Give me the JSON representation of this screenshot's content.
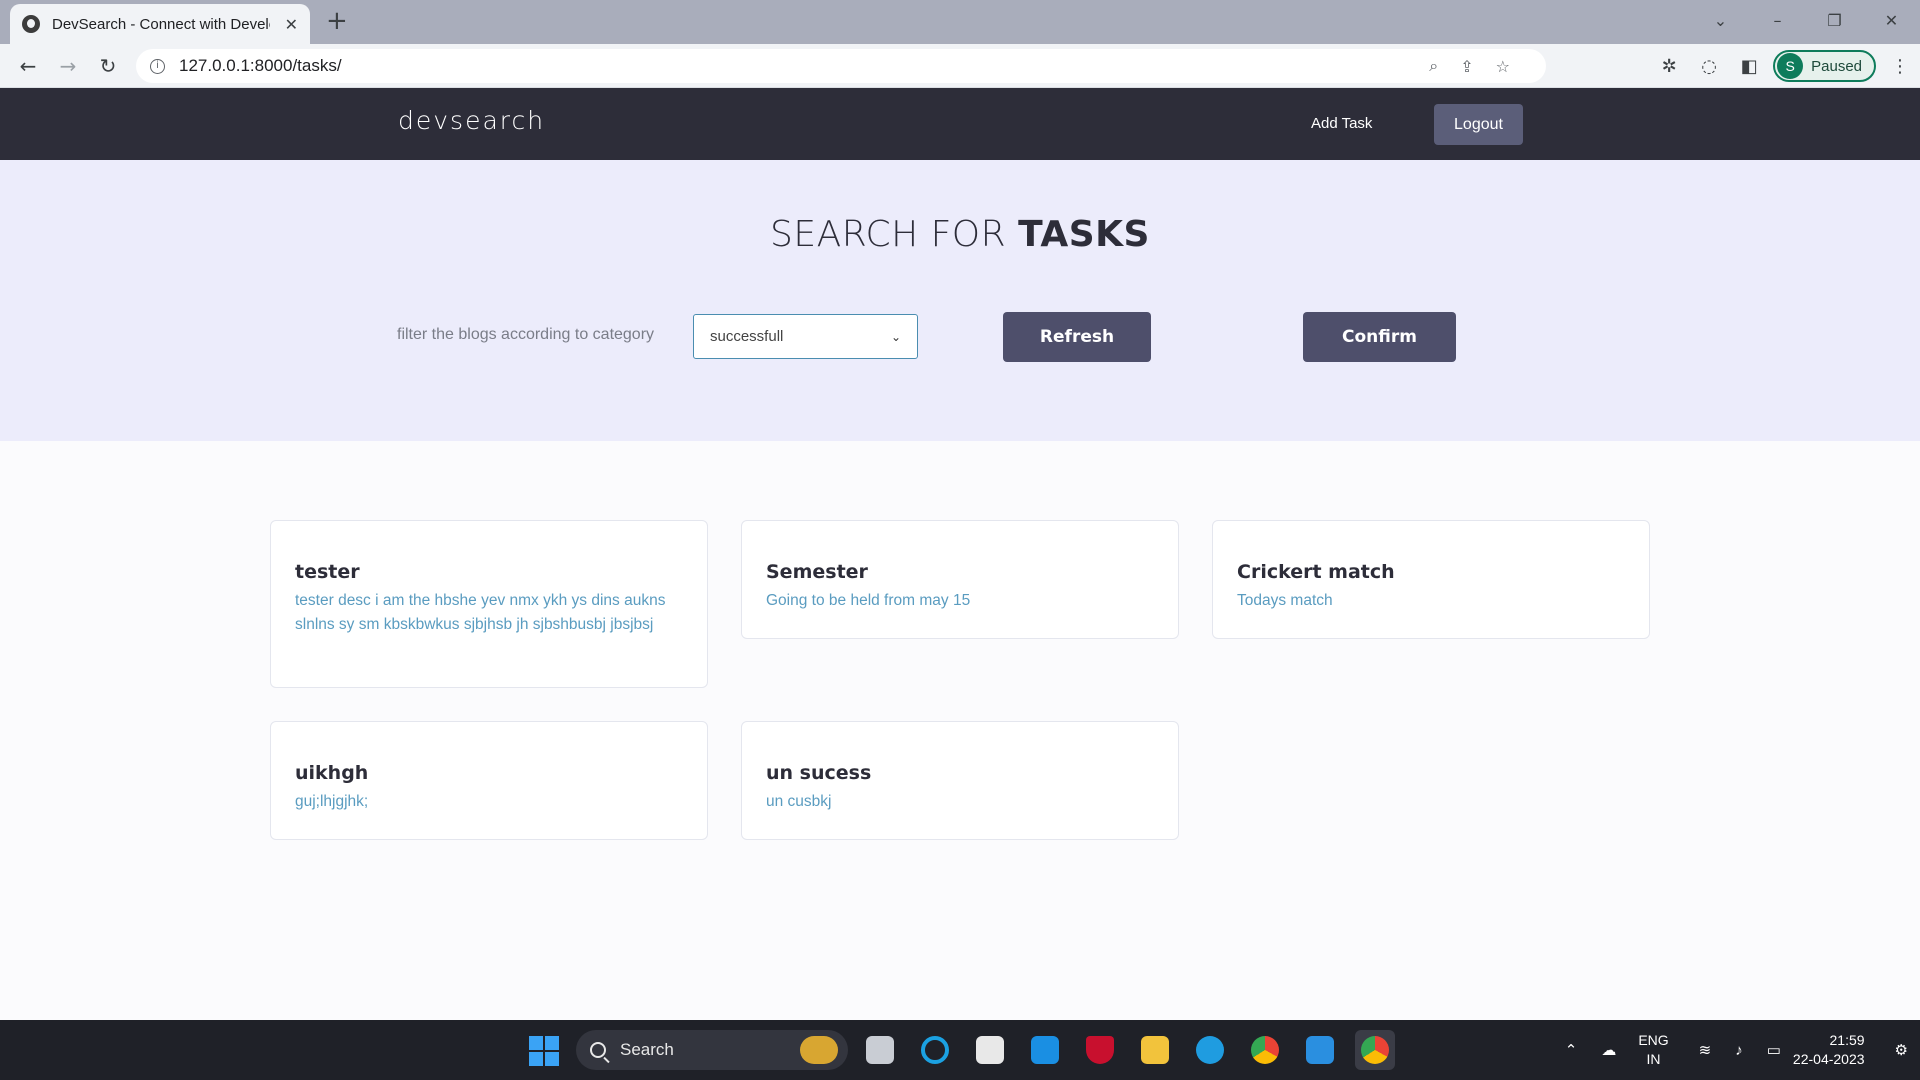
{
  "browser": {
    "tab_title": "DevSearch - Connect with Develo",
    "tab_close": "✕",
    "new_tab": "+",
    "url": "127.0.0.1:8000/tasks/",
    "profile_initial": "S",
    "profile_label": "Paused"
  },
  "site": {
    "logo": "devsearch",
    "nav_add_task": "Add Task",
    "nav_logout": "Logout"
  },
  "hero": {
    "title_light": "SEARCH FOR ",
    "title_bold": "TASKS",
    "filter_label": "filter the blogs according to category",
    "select_value": "successfull",
    "refresh_label": "Refresh",
    "confirm_label": "Confirm"
  },
  "tasks": [
    {
      "title": "tester",
      "desc": "tester desc i am the hbshe yev nmx ykh ys dins aukns slnlns sy sm kbskbwkus sjbjhsb jh sjbshbusbj jbsjbsj"
    },
    {
      "title": "Semester",
      "desc": "Going to be held from may 15"
    },
    {
      "title": "Crickert match",
      "desc": "Todays match"
    },
    {
      "title": "uikhgh",
      "desc": "guj;lhjgjhk;"
    },
    {
      "title": "un sucess",
      "desc": "un cusbkj"
    }
  ],
  "taskbar": {
    "search_label": "Search",
    "lang_top": "ENG",
    "lang_bottom": "IN",
    "time": "21:59",
    "date": "22-04-2023"
  },
  "colors": {
    "nav_bg": "#2d2d39",
    "hero_bg": "#ececfb",
    "button": "#4e4f6b",
    "card_desc": "#5a9cc0"
  }
}
